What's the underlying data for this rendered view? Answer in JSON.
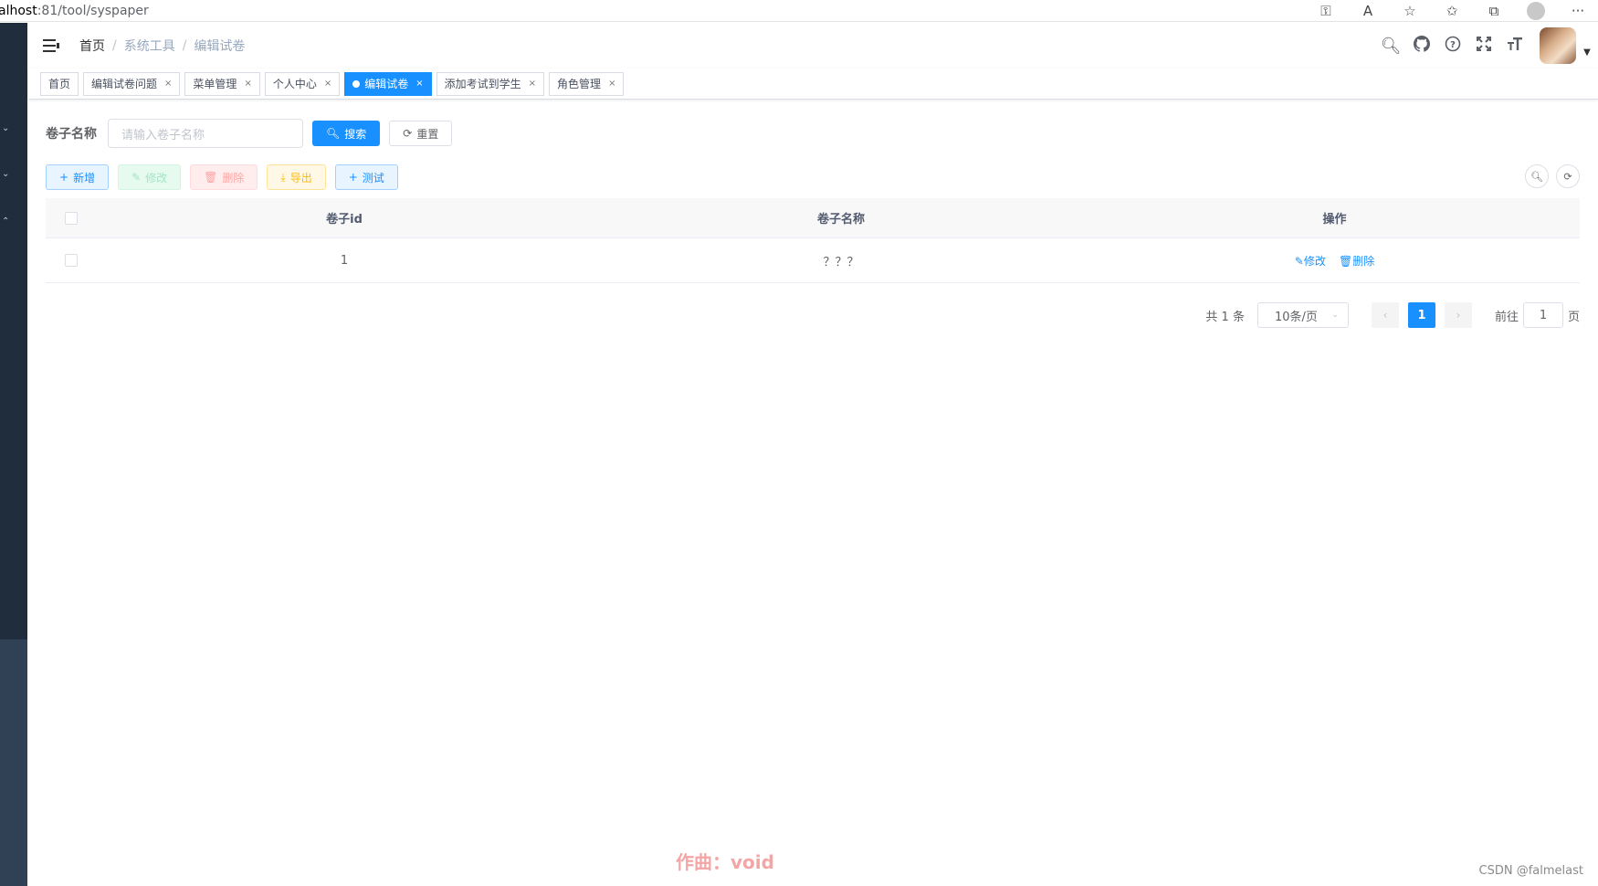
{
  "browser": {
    "url_host": "alhost",
    "url_path": ":81/tool/syspaper"
  },
  "breadcrumb": [
    "首页",
    "系统工具",
    "编辑试卷"
  ],
  "tags": [
    {
      "label": "首页",
      "closable": false,
      "active": false
    },
    {
      "label": "编辑试卷问题",
      "closable": true,
      "active": false
    },
    {
      "label": "菜单管理",
      "closable": true,
      "active": false
    },
    {
      "label": "个人中心",
      "closable": true,
      "active": false
    },
    {
      "label": "编辑试卷",
      "closable": true,
      "active": true
    },
    {
      "label": "添加考试到学生",
      "closable": true,
      "active": false
    },
    {
      "label": "角色管理",
      "closable": true,
      "active": false
    }
  ],
  "search": {
    "label": "卷子名称",
    "placeholder": "请输入卷子名称",
    "search_btn": "搜索",
    "reset_btn": "重置"
  },
  "toolbar": {
    "add": "新增",
    "edit": "修改",
    "delete": "删除",
    "export": "导出",
    "test": "测试"
  },
  "table": {
    "columns": [
      "卷子id",
      "卷子名称",
      "操作"
    ],
    "rows": [
      {
        "id": "1",
        "name": "？？？",
        "edit": "修改",
        "delete": "删除"
      }
    ]
  },
  "pagination": {
    "total_text": "共 1 条",
    "page_size": "10条/页",
    "current_page": "1",
    "goto_prefix": "前往",
    "goto_value": "1",
    "goto_suffix": "页"
  },
  "watermark": "作曲：void",
  "credit": "CSDN @falmelast",
  "colors": {
    "primary": "#1890ff",
    "sidebar": "#304156",
    "sidebar_dark": "#1f2d3d"
  }
}
